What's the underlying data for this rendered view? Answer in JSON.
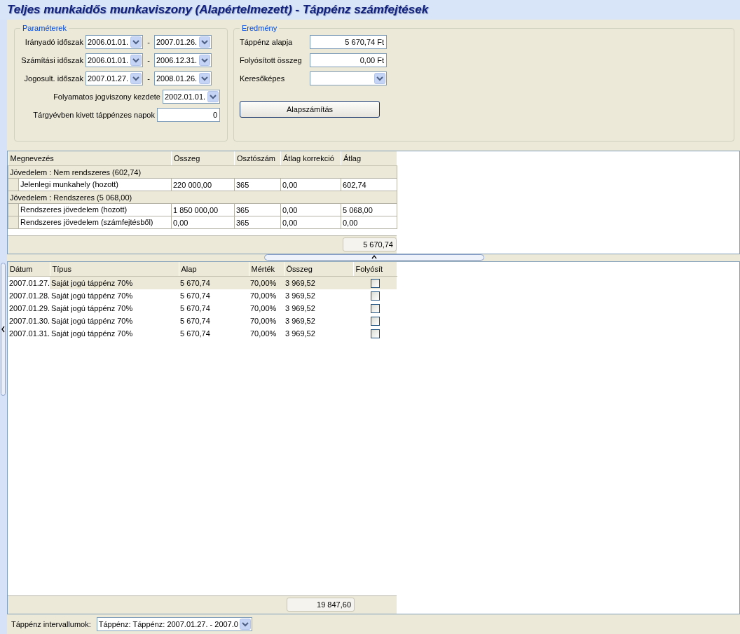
{
  "title": "Teljes munkaidős munkaviszony (Alapértelmezett) - Táppénz számfejtések",
  "parameters": {
    "legend": "Paraméterek",
    "periods": [
      {
        "label": "Irányadó időszak",
        "from": "2006.01.01.",
        "separator": "-",
        "to": "2007.01.26."
      },
      {
        "label": "Számítási időszak",
        "from": "2006.01.01.",
        "separator": "-",
        "to": "2006.12.31."
      },
      {
        "label": "Jogosult. időszak",
        "from": "2007.01.27.",
        "separator": "-",
        "to": "2008.01.26."
      }
    ],
    "start": {
      "label": "Folyamatos jogviszony kezdete",
      "value": "2002.01.01."
    },
    "days": {
      "label": "Tárgyévben kivett táppénzes napok",
      "value": "0"
    }
  },
  "result": {
    "legend": "Eredmény",
    "fields": [
      {
        "label": "Táppénz alapja",
        "kind": "text",
        "value": "5 670,74 Ft"
      },
      {
        "label": "Folyósított összeg",
        "kind": "text",
        "value": "0,00 Ft"
      },
      {
        "label": "Keresőképes",
        "kind": "combo"
      }
    ],
    "button": "Alapszámítás"
  },
  "income_table": {
    "columns": [
      "Megnevezés",
      "Összeg",
      "Osztószám",
      "Átlag korrekció",
      "Átlag"
    ],
    "groups": [
      {
        "title": "Jövedelem : Nem rendszeres (602,74)",
        "rows": [
          [
            "Jelenlegi munkahely (hozott)",
            "220 000,00",
            "365",
            "0,00",
            "602,74"
          ]
        ]
      },
      {
        "title": "Jövedelem : Rendszeres (5 068,00)",
        "rows": [
          [
            "Rendszeres jövedelem (hozott)",
            "1 850 000,00",
            "365",
            "0,00",
            "5 068,00"
          ],
          [
            "Rendszeres jövedelem (számfejtésből)",
            "0,00",
            "365",
            "0,00",
            "0,00"
          ]
        ]
      }
    ],
    "total": "5 670,74"
  },
  "payments_table": {
    "columns": [
      "Dátum",
      "Típus",
      "Alap",
      "Mérték",
      "Összeg",
      "Folyósít"
    ],
    "rows": [
      {
        "date": "2007.01.27.",
        "type": "Saját jogú táppénz 70%",
        "base": "5 670,74",
        "rate": "70,00%",
        "amount": "3 969,52",
        "paid": false,
        "selected": true
      },
      {
        "date": "2007.01.28.",
        "type": "Saját jogú táppénz 70%",
        "base": "5 670,74",
        "rate": "70,00%",
        "amount": "3 969,52",
        "paid": false,
        "selected": false
      },
      {
        "date": "2007.01.29.",
        "type": "Saját jogú táppénz 70%",
        "base": "5 670,74",
        "rate": "70,00%",
        "amount": "3 969,52",
        "paid": false,
        "selected": false
      },
      {
        "date": "2007.01.30.",
        "type": "Saját jogú táppénz 70%",
        "base": "5 670,74",
        "rate": "70,00%",
        "amount": "3 969,52",
        "paid": false,
        "selected": false
      },
      {
        "date": "2007.01.31.",
        "type": "Saját jogú táppénz 70%",
        "base": "5 670,74",
        "rate": "70,00%",
        "amount": "3 969,52",
        "paid": false,
        "selected": false
      }
    ],
    "total": "19 847,60"
  },
  "footer": {
    "label": "Táppénz intervallumok:",
    "value": "Táppénz: Táppénz: 2007.01.27. - 2007.0"
  }
}
